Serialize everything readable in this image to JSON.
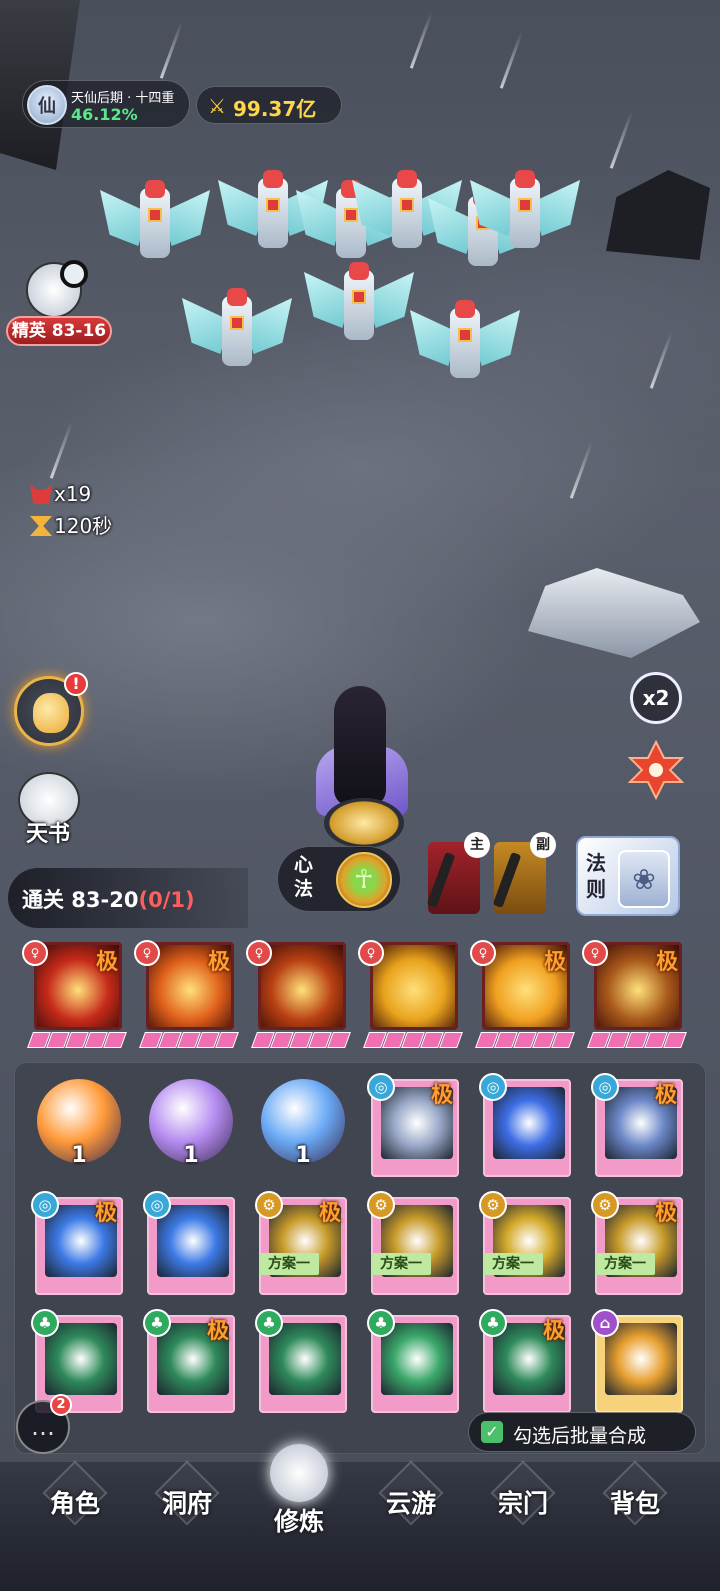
{
  "hud": {
    "realm": "天仙后期 · 十四重",
    "realm_percent": "46.12%",
    "power": "99.37亿",
    "elite_stage": "精英 83-16",
    "kills": "x19",
    "timer": "120秒"
  },
  "side": {
    "tianshu_label": "天书",
    "bag_alert": "!",
    "speed": "x2"
  },
  "stage": {
    "label": "通关 83-20",
    "progress": "(0/1)"
  },
  "xinfa_label": "心法",
  "weapons": {
    "main_tag": "主",
    "sub_tag": "副"
  },
  "faze_label": "法则",
  "equipped": [
    {
      "ji": "极",
      "color": "#c62a1a"
    },
    {
      "ji": "极",
      "color": "#e0601a"
    },
    {
      "ji": "",
      "color": "#b84012"
    },
    {
      "ji": "",
      "color": "#e8a21c"
    },
    {
      "ji": "极",
      "color": "#f0a020"
    },
    {
      "ji": "极",
      "color": "#a8581a"
    }
  ],
  "inventory": {
    "orbs": [
      {
        "count": "1",
        "color": "#ff9a3a"
      },
      {
        "count": "1",
        "color": "#b58cf0"
      },
      {
        "count": "1",
        "color": "#6aaaf5"
      }
    ],
    "cards_row1": [
      {
        "ji": "极",
        "art": "#9aa9c8",
        "elem": "#38a8d8"
      },
      {
        "ji": "",
        "art": "#3d6ee6",
        "elem": "#38a8d8"
      },
      {
        "ji": "极",
        "art": "#6c88c8",
        "elem": "#38a8d8"
      }
    ],
    "cards_row2": [
      {
        "ji": "极",
        "art": "#3d7ae6",
        "elem": "#38a8d8",
        "plan": ""
      },
      {
        "ji": "",
        "art": "#3d7ae6",
        "elem": "#38a8d8",
        "plan": ""
      },
      {
        "ji": "极",
        "art": "#c79a2a",
        "elem": "#d69a24",
        "plan": "方案一"
      },
      {
        "ji": "",
        "art": "#c79a2a",
        "elem": "#d69a24",
        "plan": "方案一"
      },
      {
        "ji": "",
        "art": "#d4aa2a",
        "elem": "#d69a24",
        "plan": "方案一"
      },
      {
        "ji": "极",
        "art": "#c79a2a",
        "elem": "#d69a24",
        "plan": "方案一"
      }
    ],
    "cards_row3": [
      {
        "ji": "",
        "art": "#2e8a5a",
        "elem": "#2faa5e",
        "gold": false
      },
      {
        "ji": "极",
        "art": "#2e8a5a",
        "elem": "#2faa5e",
        "gold": false
      },
      {
        "ji": "",
        "art": "#2e8a5a",
        "elem": "#2faa5e",
        "gold": false
      },
      {
        "ji": "",
        "art": "#3aa86a",
        "elem": "#2faa5e",
        "gold": false
      },
      {
        "ji": "极",
        "art": "#2e8a5a",
        "elem": "#2faa5e",
        "gold": false
      },
      {
        "ji": "",
        "art": "#e8a030",
        "elem": "#a050c8",
        "gold": true
      }
    ],
    "batch_label": "勾选后批量合成",
    "chat_badge": "2"
  },
  "nav": [
    {
      "label": "角色"
    },
    {
      "label": "洞府"
    },
    {
      "label": "修炼"
    },
    {
      "label": "云游"
    },
    {
      "label": "宗门"
    },
    {
      "label": "背包"
    }
  ]
}
